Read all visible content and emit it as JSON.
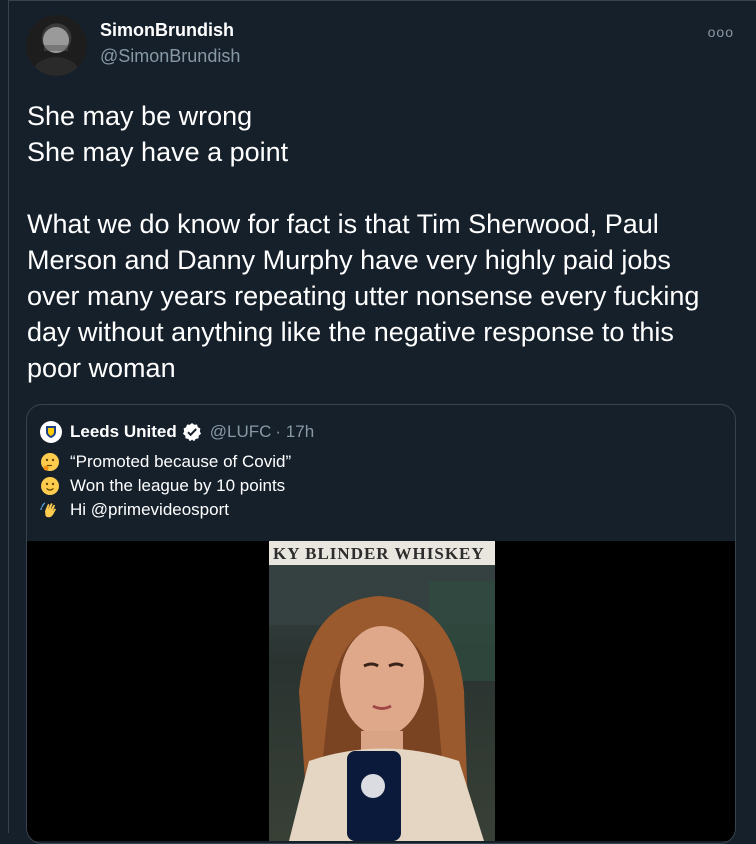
{
  "tweet": {
    "author_name": "SimonBrundish",
    "author_handle": "@SimonBrundish",
    "more_label": "ooo",
    "lines": [
      "She may be wrong",
      "She may have a point",
      "",
      "What we do know for fact is that Tim Sherwood, Paul",
      "Merson and Danny Murphy have very highly paid jobs",
      "over many years repeating utter nonsense every fucking",
      "day without anything like the negative response to this",
      "poor woman"
    ]
  },
  "quoted_tweet": {
    "author_name": "Leeds United",
    "author_handle": "@LUFC",
    "time": "· 17h",
    "lines": [
      {
        "icon": "thinking-face-icon",
        "text": "“Promoted because of Covid”"
      },
      {
        "icon": "slightly-smiling-face-icon",
        "text": "Won the league by 10 points"
      },
      {
        "icon": "waving-hand-icon",
        "text": "Hi @primevideosport"
      }
    ],
    "media": {
      "banner_text": "KY BLINDER WHISKEY"
    }
  },
  "colors": {
    "background": "#15202b",
    "secondary_text": "#8899a6",
    "border": "#38444d",
    "verified": "#ffffff"
  }
}
